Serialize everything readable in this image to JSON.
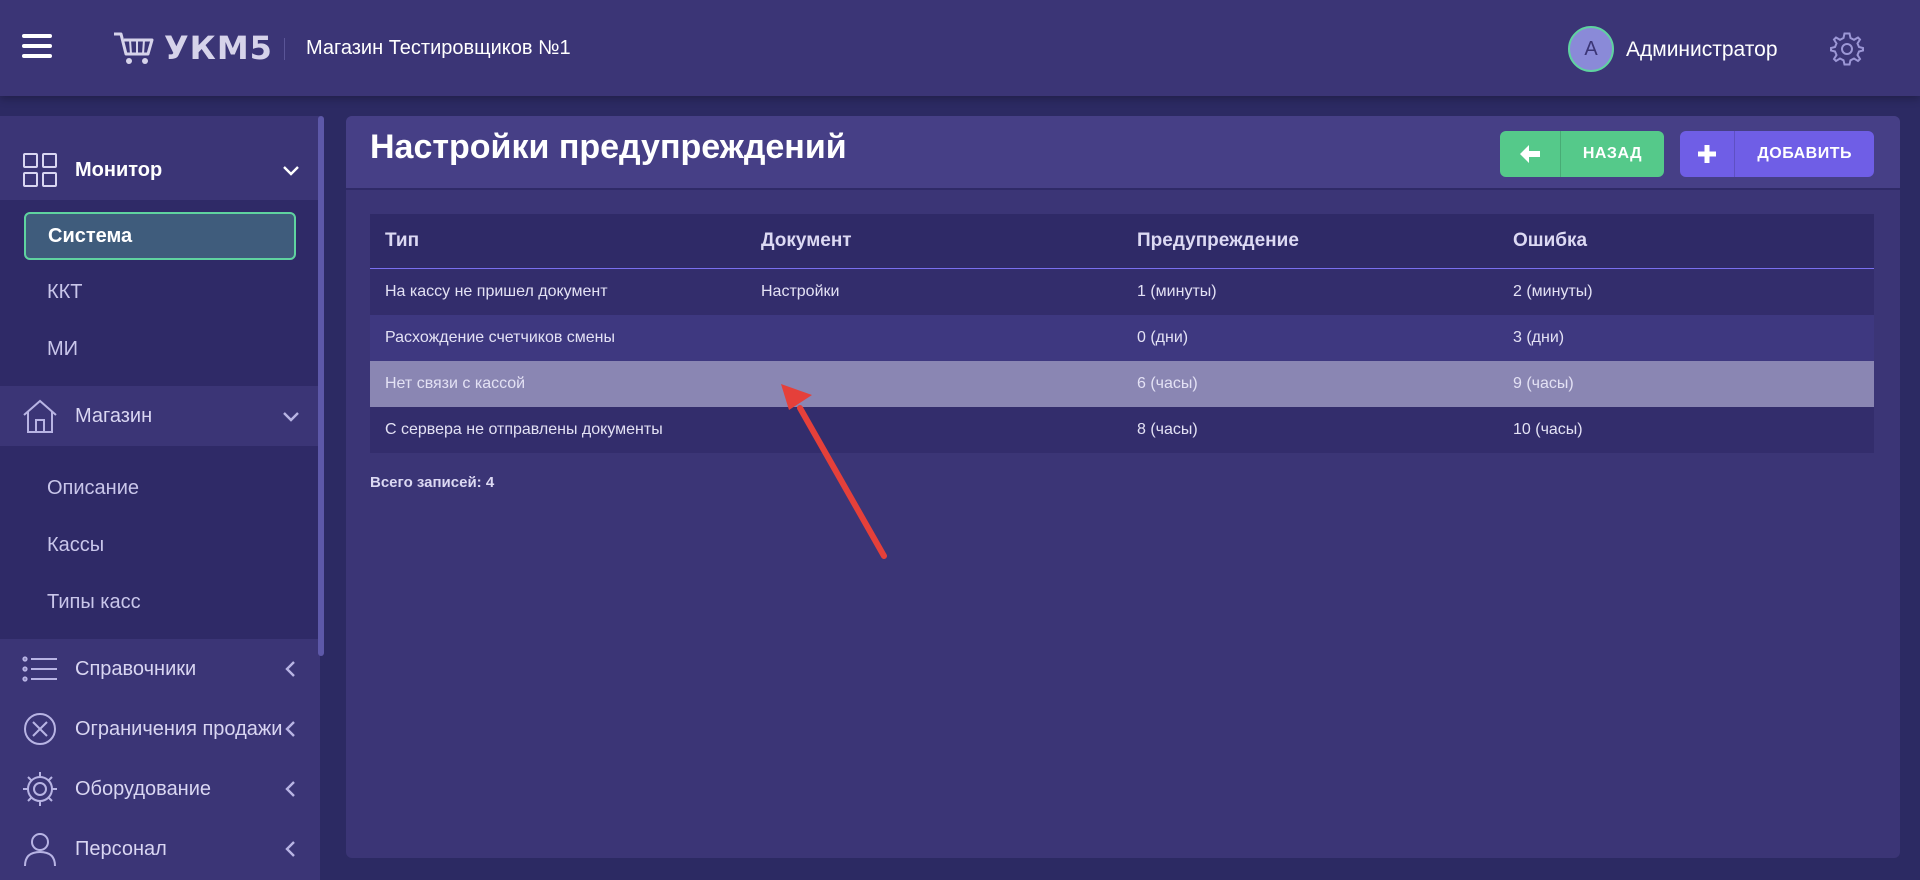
{
  "header": {
    "logo_text": "УКМ5",
    "store_name": "Магазин Тестировщиков №1",
    "avatar_letter": "А",
    "user_name": "Администратор"
  },
  "sidebar": {
    "sections": [
      {
        "label": "Монитор",
        "icon": "monitor-grid-icon",
        "items": [
          "Система",
          "ККТ",
          "МИ"
        ]
      },
      {
        "label": "Магазин",
        "icon": "home-icon",
        "items": [
          "Описание",
          "Кассы",
          "Типы касс"
        ]
      },
      {
        "label": "Справочники",
        "icon": "list-icon"
      },
      {
        "label": "Ограничения продажи",
        "icon": "cancel-circle-icon"
      },
      {
        "label": "Оборудование",
        "icon": "gear-icon"
      },
      {
        "label": "Персонал",
        "icon": "user-icon"
      }
    ]
  },
  "main": {
    "title": "Настройки предупреждений",
    "back_label": "НАЗАД",
    "add_label": "ДОБАВИТЬ",
    "table": {
      "headers": [
        "Тип",
        "Документ",
        "Предупреждение",
        "Ошибка"
      ],
      "rows": [
        [
          "На кассу не пришел документ",
          "Настройки",
          "1 (минуты)",
          "2 (минуты)"
        ],
        [
          "Расхождение счетчиков смены",
          "",
          "0 (дни)",
          "3 (дни)"
        ],
        [
          "Нет связи с кассой",
          "",
          "6 (часы)",
          "9 (часы)"
        ],
        [
          "С сервера не отправлены документы",
          "",
          "8 (часы)",
          "10 (часы)"
        ]
      ]
    },
    "total_label": "Всего записей: 4"
  },
  "colors": {
    "accent_green": "#55c98a",
    "accent_purple": "#6f5ee6",
    "annotation_arrow": "#e5403a"
  }
}
